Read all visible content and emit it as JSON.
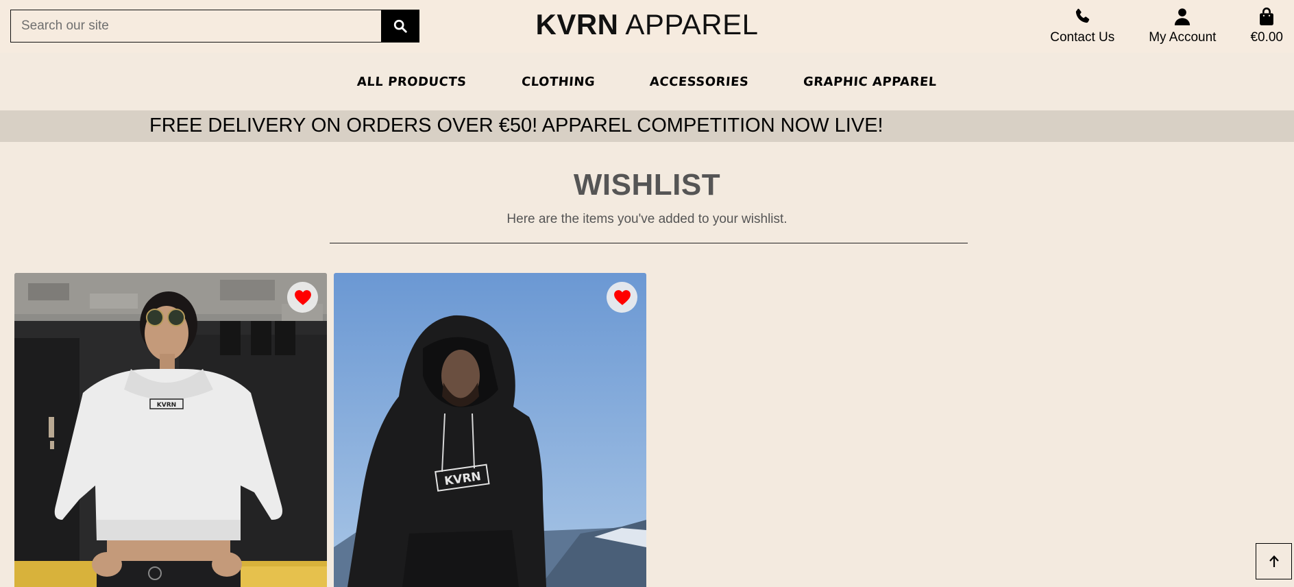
{
  "header": {
    "search": {
      "placeholder": "Search our site",
      "value": ""
    },
    "brand": {
      "bold": "KVRN",
      "rest": "APPAREL"
    },
    "links": {
      "contact": "Contact Us",
      "account": "My Account",
      "bag_total": "€0.00"
    }
  },
  "nav": {
    "items": [
      "All Products",
      "Clothing",
      "Accessories",
      "Graphic Apparel"
    ]
  },
  "banner": {
    "text": "FREE DELIVERY ON ORDERS OVER €50! APPAREL COMPETITION NOW LIVE!"
  },
  "wishlist": {
    "title": "WISHLIST",
    "subtitle": "Here are the items you've added to your wishlist.",
    "items": [
      {
        "logo": "KVRN",
        "garment": "white cropped hoodie"
      },
      {
        "logo": "KVRN",
        "garment": "black hoodie"
      }
    ]
  },
  "icons": {
    "search": "search-icon",
    "phone": "phone-icon",
    "user": "user-icon",
    "bag": "shopping-bag-icon",
    "heart": "heart-icon",
    "arrow_up": "arrow-up-icon"
  },
  "colors": {
    "page_bg": "#f3eadf",
    "header_bg": "#f6ebdf",
    "banner_bg": "#d8d0c5",
    "heart": "#ff0000",
    "muted_text": "#555555"
  }
}
